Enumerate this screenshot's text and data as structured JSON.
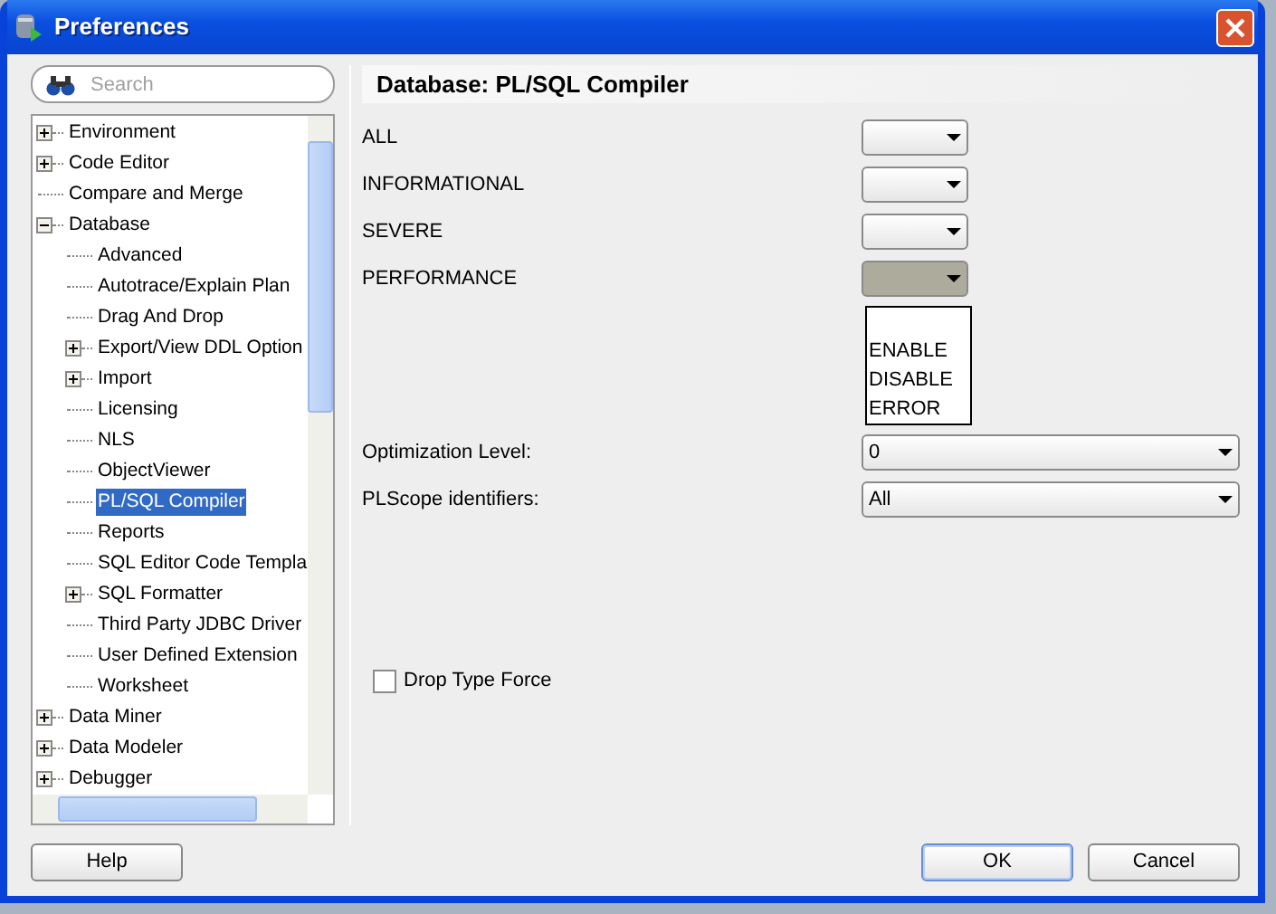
{
  "window": {
    "title": "Preferences"
  },
  "search": {
    "placeholder": "Search"
  },
  "tree": [
    {
      "label": "Environment",
      "expanded": false,
      "selected": false
    },
    {
      "label": "Code Editor",
      "expanded": false,
      "selected": false
    },
    {
      "label": "Compare and Merge",
      "selected": false
    },
    {
      "label": "Database",
      "expanded": true,
      "selected": false,
      "children": [
        {
          "label": "Advanced",
          "selected": false
        },
        {
          "label": "Autotrace/Explain Plan",
          "selected": false
        },
        {
          "label": "Drag And Drop",
          "selected": false
        },
        {
          "label": "Export/View DDL Option",
          "expanded": false,
          "selected": false
        },
        {
          "label": "Import",
          "expanded": false,
          "selected": false
        },
        {
          "label": "Licensing",
          "selected": false
        },
        {
          "label": "NLS",
          "selected": false
        },
        {
          "label": "ObjectViewer",
          "selected": false
        },
        {
          "label": "PL/SQL Compiler",
          "selected": true
        },
        {
          "label": "Reports",
          "selected": false
        },
        {
          "label": "SQL Editor Code Templa",
          "selected": false
        },
        {
          "label": "SQL Formatter",
          "expanded": false,
          "selected": false
        },
        {
          "label": "Third Party JDBC Driver",
          "selected": false
        },
        {
          "label": "User Defined Extension",
          "selected": false
        },
        {
          "label": "Worksheet",
          "selected": false
        }
      ]
    },
    {
      "label": "Data Miner",
      "expanded": false,
      "selected": false
    },
    {
      "label": "Data Modeler",
      "expanded": false,
      "selected": false
    },
    {
      "label": "Debugger",
      "expanded": false,
      "selected": false
    }
  ],
  "page_title": "Database: PL/SQL Compiler",
  "warnings": [
    {
      "label": "ALL",
      "expanded": false
    },
    {
      "label": "INFORMATIONAL",
      "expanded": false
    },
    {
      "label": "SEVERE",
      "expanded": false
    },
    {
      "label": "PERFORMANCE",
      "expanded": true,
      "options": [
        "ENABLE",
        "DISABLE",
        "ERROR"
      ]
    }
  ],
  "settings": [
    {
      "label": "Optimization Level:",
      "value": "0"
    },
    {
      "label": "PLScope identifiers:",
      "value": "All"
    }
  ],
  "checkbox": {
    "label": "Drop Type Force",
    "checked": false
  },
  "buttons": [
    {
      "label": "Help",
      "kind": "help"
    },
    {
      "label": "OK",
      "kind": "default"
    },
    {
      "label": "Cancel",
      "kind": "normal"
    }
  ]
}
